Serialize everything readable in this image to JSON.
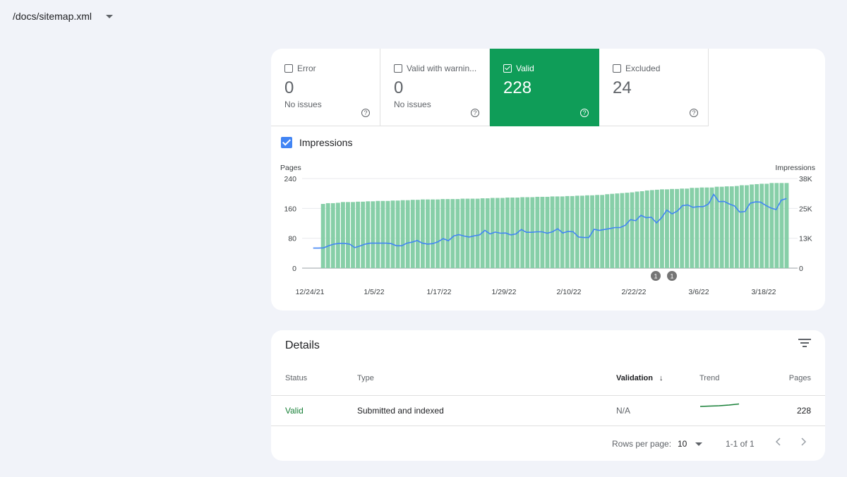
{
  "header": {
    "sitemap": "/docs/sitemap.xml"
  },
  "tiles": [
    {
      "label": "Error",
      "value": "0",
      "sub": "No issues",
      "checked": false
    },
    {
      "label": "Valid with warnin...",
      "value": "0",
      "sub": "No issues",
      "checked": false
    },
    {
      "label": "Valid",
      "value": "228",
      "sub": "",
      "checked": true
    },
    {
      "label": "Excluded",
      "value": "24",
      "sub": "",
      "checked": false
    }
  ],
  "impressions_toggle": "Impressions",
  "colors": {
    "valid": "#0f9d58",
    "bars": "#87cfa8",
    "impressions_line": "#4285f4",
    "status_green": "#188038"
  },
  "chart_data": {
    "type": "bar",
    "left_axis_title": "Pages",
    "right_axis_title": "Impressions",
    "left_ticks": [
      "0",
      "80",
      "160",
      "240"
    ],
    "right_ticks": [
      "0",
      "13K",
      "25K",
      "38K"
    ],
    "x_ticks": [
      "12/24/21",
      "1/5/22",
      "1/17/22",
      "1/29/22",
      "2/10/22",
      "2/22/22",
      "3/6/22",
      "3/18/22"
    ],
    "annotations": [
      "1",
      "1"
    ],
    "ylim_pages": [
      0,
      240
    ],
    "ylim_impressions": [
      0,
      38000
    ],
    "series": [
      {
        "name": "Pages",
        "values": [
          0,
          0,
          172,
          174,
          174,
          175,
          177,
          177,
          177,
          178,
          178,
          179,
          179,
          180,
          180,
          180,
          181,
          181,
          182,
          182,
          183,
          183,
          184,
          184,
          184,
          184,
          185,
          185,
          185,
          185,
          186,
          186,
          186,
          186,
          187,
          187,
          188,
          188,
          188,
          189,
          189,
          189,
          190,
          190,
          190,
          191,
          191,
          191,
          192,
          192,
          192,
          193,
          193,
          194,
          194,
          195,
          195,
          196,
          196,
          198,
          199,
          200,
          201,
          202,
          203,
          205,
          206,
          208,
          209,
          210,
          211,
          211,
          212,
          212,
          213,
          213,
          215,
          215,
          216,
          216,
          216,
          218,
          218,
          219,
          219,
          220,
          222,
          222,
          224,
          225,
          226,
          226,
          228,
          228,
          228,
          228
        ]
      },
      {
        "name": "Impressions",
        "values": [
          8500,
          8500,
          8600,
          9500,
          10200,
          10500,
          10500,
          10200,
          8700,
          9400,
          10200,
          10600,
          10600,
          10600,
          10600,
          10400,
          9500,
          9500,
          10600,
          11000,
          11700,
          10600,
          10200,
          10400,
          11200,
          12500,
          11600,
          13600,
          14200,
          13600,
          13200,
          13700,
          14100,
          16000,
          14500,
          15300,
          14800,
          14900,
          14100,
          14500,
          16400,
          15200,
          15200,
          15400,
          15400,
          14800,
          15400,
          16700,
          14900,
          15600,
          15400,
          13200,
          13000,
          13000,
          16500,
          16000,
          16400,
          16800,
          17200,
          17200,
          18200,
          20600,
          20100,
          22400,
          21400,
          21600,
          19200,
          21400,
          24600,
          23000,
          24200,
          26500,
          26800,
          25800,
          26100,
          26100,
          27200,
          31300,
          28200,
          28300,
          27200,
          26400,
          23800,
          24000,
          27500,
          28100,
          28000,
          26600,
          25500,
          24800,
          28800,
          29500
        ]
      }
    ]
  },
  "details": {
    "title": "Details",
    "columns": {
      "status": "Status",
      "type": "Type",
      "validation": "Validation",
      "trend": "Trend",
      "pages": "Pages"
    },
    "rows": [
      {
        "status": "Valid",
        "type": "Submitted and indexed",
        "validation": "N/A",
        "pages": "228"
      }
    ],
    "footer": {
      "rows_per_page_label": "Rows per page:",
      "rows_per_page": "10",
      "range": "1-1 of 1"
    }
  }
}
